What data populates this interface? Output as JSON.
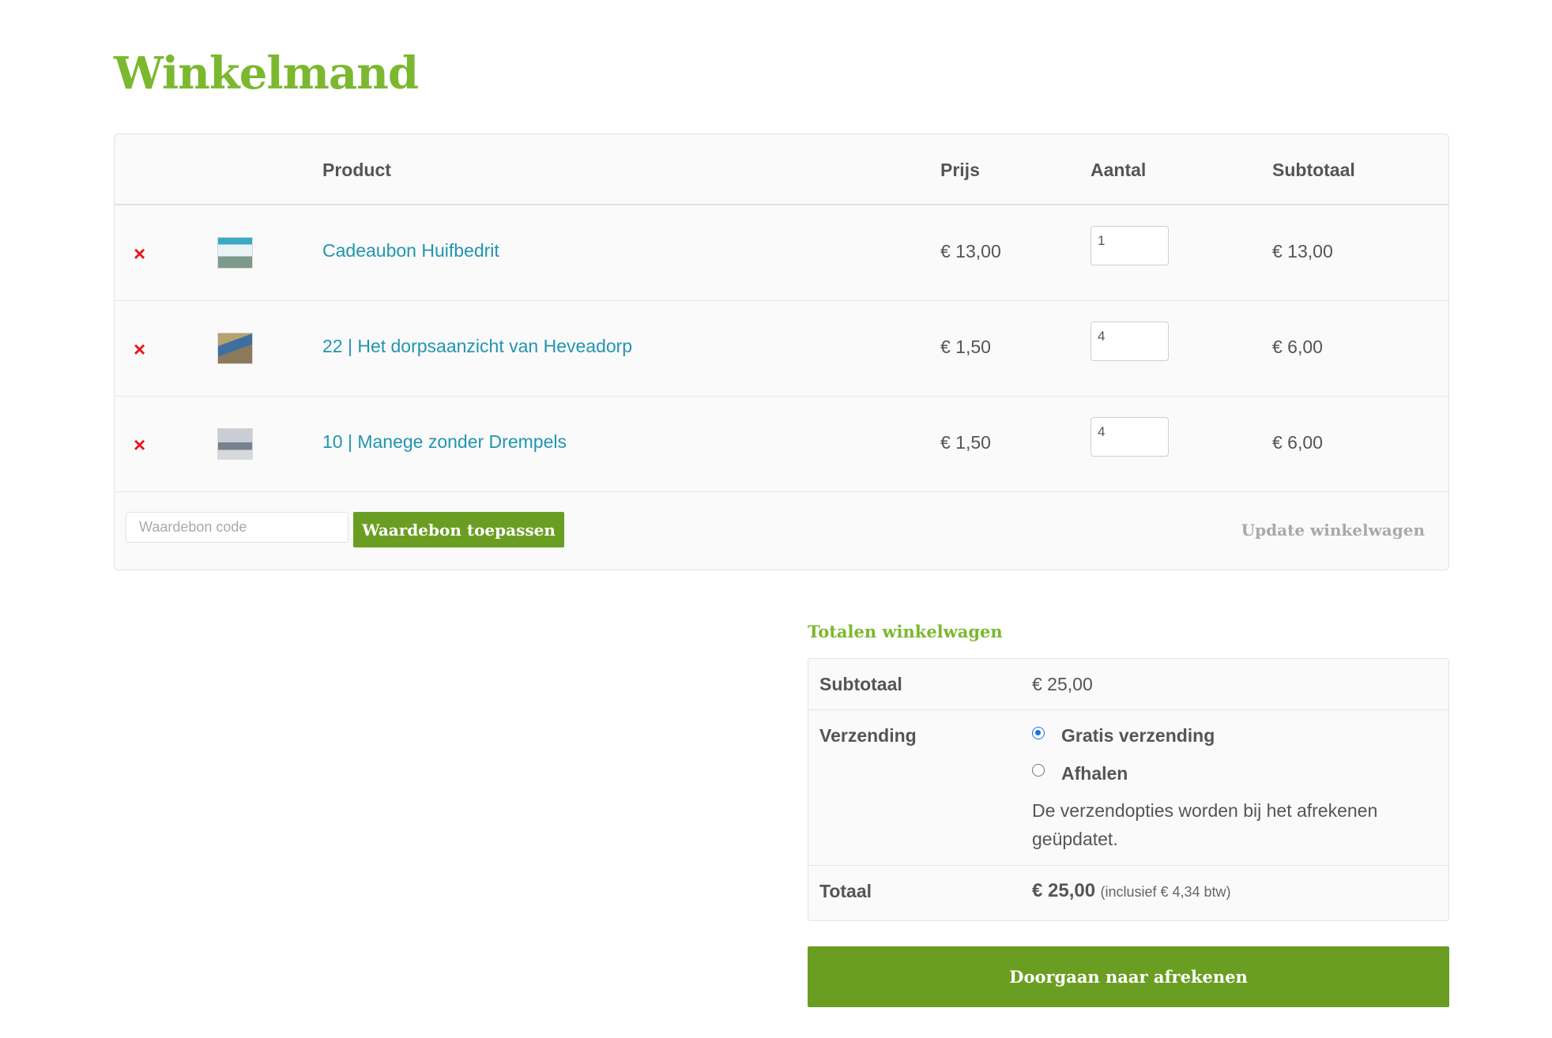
{
  "page": {
    "title": "Winkelmand"
  },
  "cart": {
    "headers": {
      "product": "Product",
      "price": "Prijs",
      "quantity": "Aantal",
      "subtotal": "Subtotaal"
    },
    "items": [
      {
        "name": "Cadeaubon Huifbedrit",
        "price": "€ 13,00",
        "quantity": "1",
        "subtotal": "€ 13,00"
      },
      {
        "name": "22 | Het dorpsaanzicht van Heveadorp",
        "price": "€ 1,50",
        "quantity": "4",
        "subtotal": "€ 6,00"
      },
      {
        "name": "10 | Manege zonder Drempels",
        "price": "€ 1,50",
        "quantity": "4",
        "subtotal": "€ 6,00"
      }
    ],
    "remove_symbol": "×",
    "coupon": {
      "placeholder": "Waardebon code",
      "button_label": "Waardebon toepassen"
    },
    "update_label": "Update winkelwagen"
  },
  "totals": {
    "title": "Totalen winkelwagen",
    "subtotal_label": "Subtotaal",
    "subtotal_value": "€ 25,00",
    "shipping_label": "Verzending",
    "shipping_options": [
      {
        "label": "Gratis verzending",
        "selected": true
      },
      {
        "label": "Afhalen",
        "selected": false
      }
    ],
    "shipping_note": "De verzendopties worden bij het afrekenen geüpdatet.",
    "total_label": "Totaal",
    "total_value": "€ 25,00",
    "tax_note": "(inclusief € 4,34 btw)"
  },
  "checkout": {
    "button_label": "Doorgaan naar afrekenen"
  },
  "colors": {
    "brand_green": "#7cb82f",
    "button_green": "#6a9e22",
    "link_blue": "#2295b0",
    "remove_red": "#e8161c"
  }
}
